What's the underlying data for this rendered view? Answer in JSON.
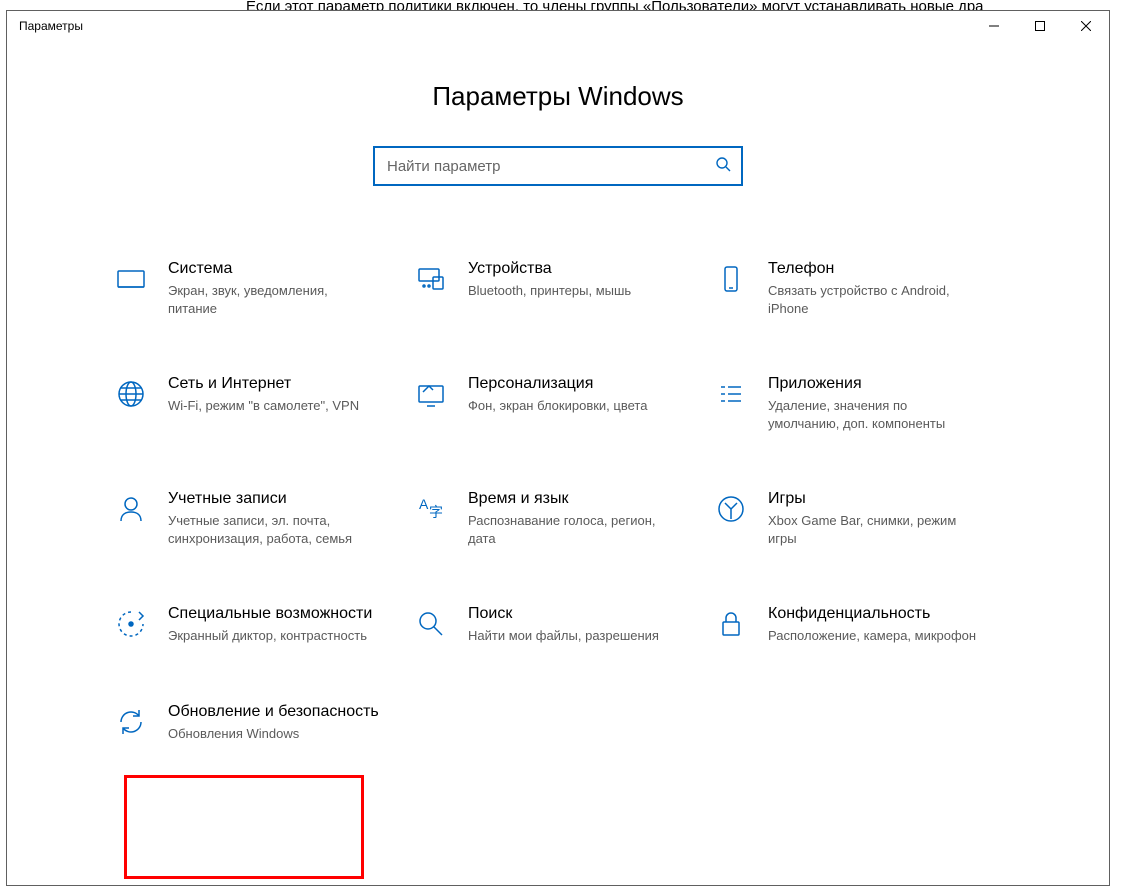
{
  "background_text": "Если этот параметр политики включен, то члены группы «Пользователи» могут устанавливать новые дра",
  "window": {
    "title": "Параметры",
    "page_title": "Параметры Windows"
  },
  "search": {
    "placeholder": "Найти параметр"
  },
  "tiles": [
    {
      "title": "Система",
      "desc": "Экран, звук, уведомления, питание"
    },
    {
      "title": "Устройства",
      "desc": "Bluetooth, принтеры, мышь"
    },
    {
      "title": "Телефон",
      "desc": "Связать устройство с Android, iPhone"
    },
    {
      "title": "Сеть и Интернет",
      "desc": "Wi-Fi, режим \"в самолете\", VPN"
    },
    {
      "title": "Персонализация",
      "desc": "Фон, экран блокировки, цвета"
    },
    {
      "title": "Приложения",
      "desc": "Удаление, значения по умолчанию, доп. компоненты"
    },
    {
      "title": "Учетные записи",
      "desc": "Учетные записи, эл. почта, синхронизация, работа, семья"
    },
    {
      "title": "Время и язык",
      "desc": "Распознавание голоса, регион, дата"
    },
    {
      "title": "Игры",
      "desc": "Xbox Game Bar, снимки, режим игры"
    },
    {
      "title": "Специальные возможности",
      "desc": "Экранный диктор, контрастность"
    },
    {
      "title": "Поиск",
      "desc": "Найти мои файлы, разрешения"
    },
    {
      "title": "Конфиденциальность",
      "desc": "Расположение, камера, микрофон"
    },
    {
      "title": "Обновление и безопасность",
      "desc": "Обновления Windows"
    }
  ]
}
